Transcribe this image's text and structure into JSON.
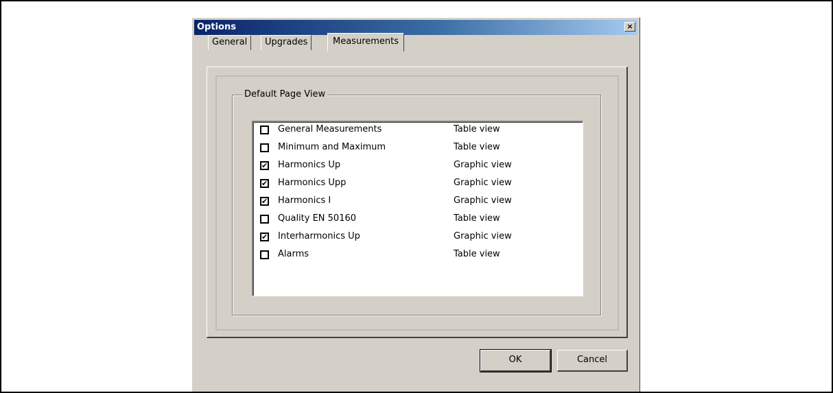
{
  "dialog": {
    "title": "Options",
    "close_label": "×"
  },
  "tabs": [
    {
      "label": "General",
      "active": false
    },
    {
      "label": "Upgrades",
      "active": false
    },
    {
      "label": "Measurements",
      "active": true
    }
  ],
  "group": {
    "label": "Default Page View"
  },
  "list": [
    {
      "label": "General Measurements",
      "view": "Table view",
      "checked": false
    },
    {
      "label": "Minimum and Maximum",
      "view": "Table view",
      "checked": false
    },
    {
      "label": "Harmonics Up",
      "view": "Graphic view",
      "checked": true
    },
    {
      "label": "Harmonics Upp",
      "view": "Graphic view",
      "checked": true
    },
    {
      "label": "Harmonics I",
      "view": "Graphic view",
      "checked": true
    },
    {
      "label": "Quality EN 50160",
      "view": "Table view",
      "checked": false
    },
    {
      "label": "Interharmonics Up",
      "view": "Graphic view",
      "checked": true
    },
    {
      "label": "Alarms",
      "view": "Table view",
      "checked": false
    }
  ],
  "buttons": {
    "ok": "OK",
    "cancel": "Cancel"
  },
  "colors": {
    "titlebar_start": "#0a246a",
    "titlebar_end": "#a6caf0",
    "face": "#d4d0c8"
  }
}
